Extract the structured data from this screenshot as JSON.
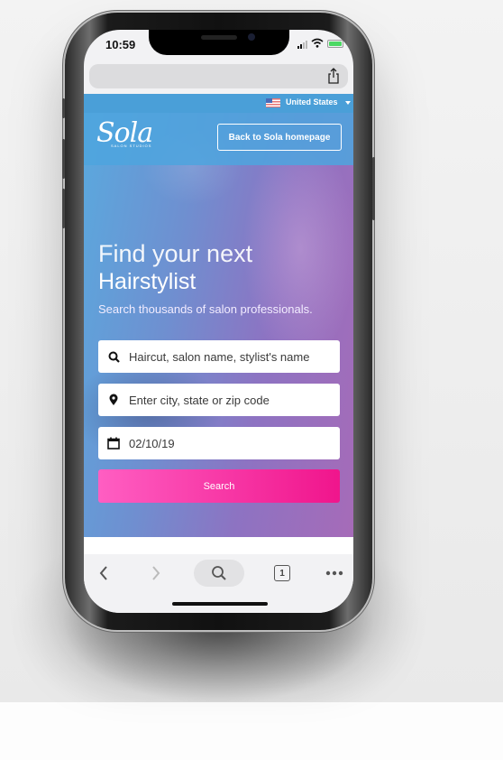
{
  "status_bar": {
    "time": "10:59",
    "icons": [
      "signal-icon",
      "wifi-icon",
      "battery-icon"
    ]
  },
  "browser": {
    "url": "",
    "share_icon": "share-icon",
    "toolbar": {
      "back_icon": "chevron-left-icon",
      "forward_icon": "chevron-right-icon",
      "search_icon": "search-icon",
      "tabs_count": "1",
      "more_icon": "ellipsis-icon"
    }
  },
  "site": {
    "country_selector": {
      "flag": "us-flag-icon",
      "label": "United States"
    },
    "logo": {
      "name": "Sola",
      "tagline": "SALON STUDIOS"
    },
    "back_button": "Back to Sola homepage",
    "hero": {
      "headline_light": "Find your next",
      "headline_bold": "Hairstylist",
      "subheading": "Search thousands of salon professionals."
    },
    "search_form": {
      "query": {
        "icon": "search-icon",
        "placeholder": "Haircut, salon name, stylist's name"
      },
      "location": {
        "icon": "map-pin-icon",
        "placeholder": "Enter city, state or zip code"
      },
      "date": {
        "icon": "calendar-icon",
        "value": "02/10/19"
      },
      "submit": "Search"
    }
  },
  "colors": {
    "brand_blue": "#4a9fd8",
    "brand_purple": "#a66bb8",
    "search_button_start": "#ff5ec2",
    "search_button_end": "#f0158c"
  }
}
